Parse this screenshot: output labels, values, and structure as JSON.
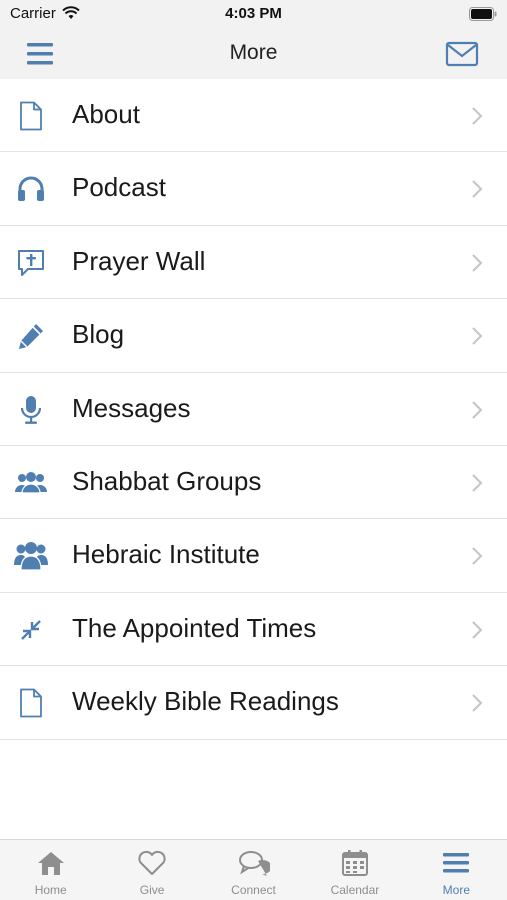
{
  "status": {
    "carrier": "Carrier",
    "time": "4:03 PM"
  },
  "nav": {
    "title": "More"
  },
  "items": [
    {
      "label": "About",
      "icon": "document-icon"
    },
    {
      "label": "Podcast",
      "icon": "headphones-icon"
    },
    {
      "label": "Prayer Wall",
      "icon": "prayer-bubble-icon"
    },
    {
      "label": "Blog",
      "icon": "pencil-icon"
    },
    {
      "label": "Messages",
      "icon": "microphone-icon"
    },
    {
      "label": "Shabbat Groups",
      "icon": "group-icon"
    },
    {
      "label": "Hebraic Institute",
      "icon": "users-icon"
    },
    {
      "label": "The Appointed Times",
      "icon": "compress-arrows-icon"
    },
    {
      "label": "Weekly Bible Readings",
      "icon": "document-icon"
    }
  ],
  "tabs": [
    {
      "label": "Home",
      "icon": "home-icon"
    },
    {
      "label": "Give",
      "icon": "heart-icon"
    },
    {
      "label": "Connect",
      "icon": "chat-bubbles-icon"
    },
    {
      "label": "Calendar",
      "icon": "calendar-icon"
    },
    {
      "label": "More",
      "icon": "menu-icon",
      "active": true
    }
  ],
  "colors": {
    "accent": "#4f7fb1",
    "inactive": "#8e8e8e",
    "bar_bg": "#f2f2f2"
  }
}
